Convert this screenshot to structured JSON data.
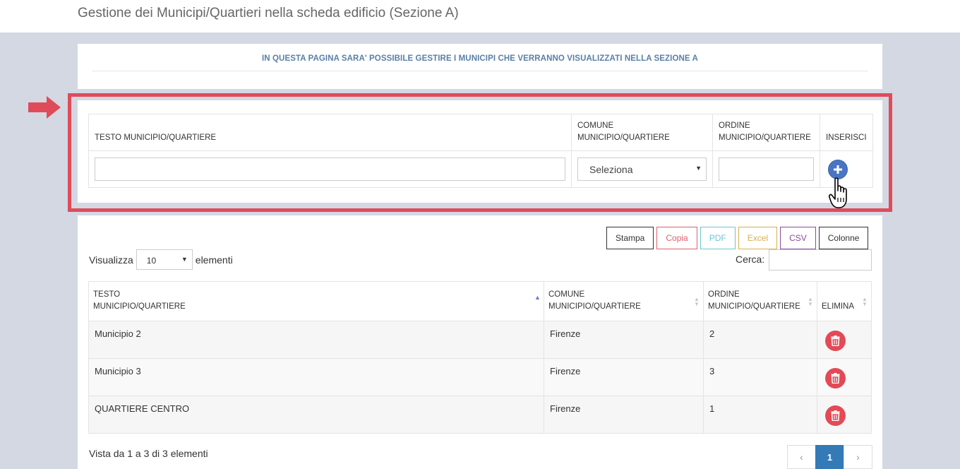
{
  "page": {
    "title": "Gestione dei Municipi/Quartieri nella scheda edificio (Sezione A)",
    "info": "IN QUESTA PAGINA SARA' POSSIBILE GESTIRE I MUNICIPI CHE VERRANNO VISUALIZZATI NELLA SEZIONE A"
  },
  "insert_form": {
    "headers": {
      "testo": "TESTO MUNICIPIO/QUARTIERE",
      "comune_l1": "COMUNE",
      "comune_l2": "MUNICIPIO/QUARTIERE",
      "ordine_l1": "ORDINE",
      "ordine_l2": "MUNICIPIO/QUARTIERE",
      "inserisci": "INSERISCI"
    },
    "testo_value": "",
    "comune_selected": "Seleziona",
    "ordine_value": "",
    "add_icon": "plus-icon"
  },
  "export_buttons": {
    "stampa": "Stampa",
    "copia": "Copia",
    "pdf": "PDF",
    "excel": "Excel",
    "csv": "CSV",
    "colonne": "Colonne"
  },
  "length_menu": {
    "prefix": "Visualizza",
    "selected": "10",
    "suffix": "elementi"
  },
  "search": {
    "label": "Cerca:",
    "value": ""
  },
  "table": {
    "headers": {
      "testo_l1": "TESTO",
      "testo_l2": "MUNICIPIO/QUARTIERE",
      "comune_l1": "COMUNE",
      "comune_l2": "MUNICIPIO/QUARTIERE",
      "ordine_l1": "ORDINE",
      "ordine_l2": "MUNICIPIO/QUARTIERE",
      "elimina": "ELIMINA"
    },
    "rows": [
      {
        "testo": "Municipio 2",
        "comune": "Firenze",
        "ordine": "2"
      },
      {
        "testo": "Municipio 3",
        "comune": "Firenze",
        "ordine": "3"
      },
      {
        "testo": "QUARTIERE CENTRO",
        "comune": "Firenze",
        "ordine": "1"
      }
    ],
    "delete_icon": "trash-icon"
  },
  "footer": {
    "info": "Vista da 1 a 3 di 3 elementi",
    "prev": "‹",
    "page": "1",
    "next": "›"
  },
  "colors": {
    "accent": "#e04b5a",
    "primary": "#337ab7",
    "add_button": "#4a75c2",
    "delete_button": "#e24a55",
    "info_text": "#5a7fa8"
  }
}
